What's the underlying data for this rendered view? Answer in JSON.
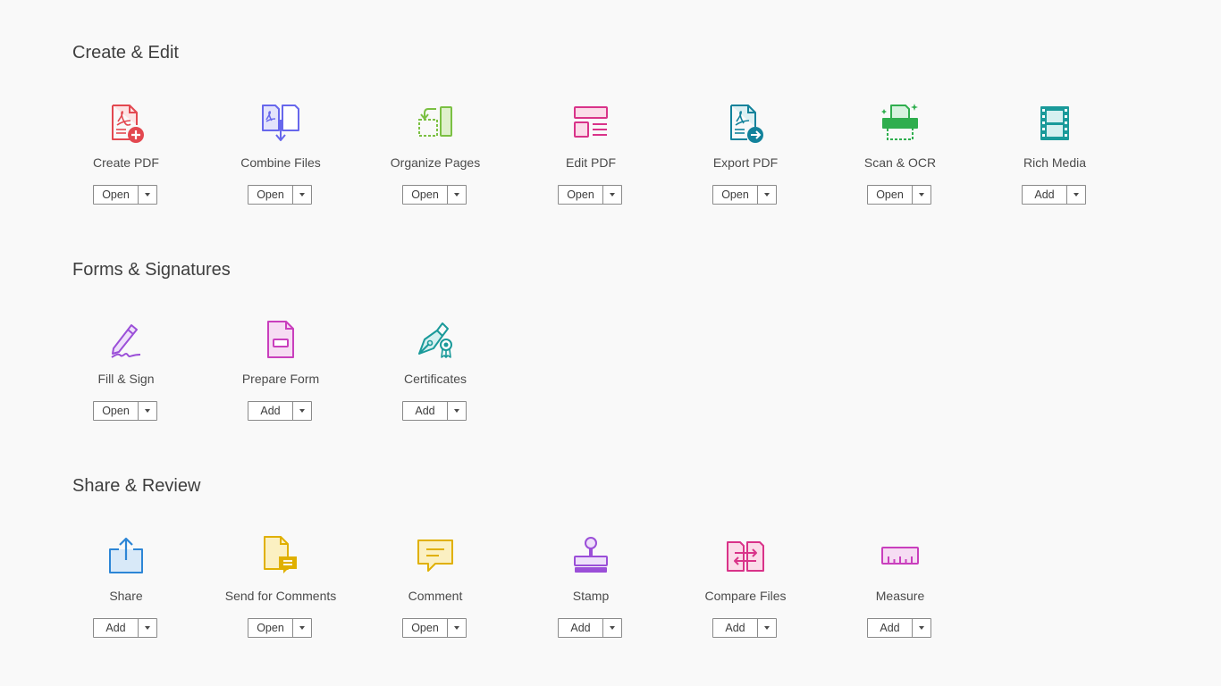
{
  "sections": [
    {
      "title": "Create & Edit",
      "tools": [
        {
          "label": "Create PDF",
          "action": "Open",
          "icon": "create-pdf-icon",
          "color": "#e34850"
        },
        {
          "label": "Combine Files",
          "action": "Open",
          "icon": "combine-files-icon",
          "color": "#6767ec"
        },
        {
          "label": "Organize Pages",
          "action": "Open",
          "icon": "organize-pages-icon",
          "color": "#7bc043"
        },
        {
          "label": "Edit PDF",
          "action": "Open",
          "icon": "edit-pdf-icon",
          "color": "#d93389"
        },
        {
          "label": "Export PDF",
          "action": "Open",
          "icon": "export-pdf-icon",
          "color": "#12829b"
        },
        {
          "label": "Scan & OCR",
          "action": "Open",
          "icon": "scan-ocr-icon",
          "color": "#2fae4e"
        },
        {
          "label": "Rich Media",
          "action": "Add",
          "icon": "rich-media-icon",
          "color": "#1a9a9a"
        }
      ]
    },
    {
      "title": "Forms & Signatures",
      "tools": [
        {
          "label": "Fill & Sign",
          "action": "Open",
          "icon": "fill-sign-icon",
          "color": "#9b4fd8"
        },
        {
          "label": "Prepare Form",
          "action": "Add",
          "icon": "prepare-form-icon",
          "color": "#c93fbd"
        },
        {
          "label": "Certificates",
          "action": "Add",
          "icon": "certificates-icon",
          "color": "#1a9a9a"
        }
      ]
    },
    {
      "title": "Share & Review",
      "tools": [
        {
          "label": "Share",
          "action": "Add",
          "icon": "share-icon",
          "color": "#2d86d6"
        },
        {
          "label": "Send for Comments",
          "action": "Open",
          "icon": "send-for-comments-icon",
          "color": "#e0b000"
        },
        {
          "label": "Comment",
          "action": "Open",
          "icon": "comment-icon",
          "color": "#e0b000"
        },
        {
          "label": "Stamp",
          "action": "Add",
          "icon": "stamp-icon",
          "color": "#9b4fd8"
        },
        {
          "label": "Compare Files",
          "action": "Add",
          "icon": "compare-files-icon",
          "color": "#d93389"
        },
        {
          "label": "Measure",
          "action": "Add",
          "icon": "measure-icon",
          "color": "#c93fbd"
        }
      ]
    }
  ]
}
